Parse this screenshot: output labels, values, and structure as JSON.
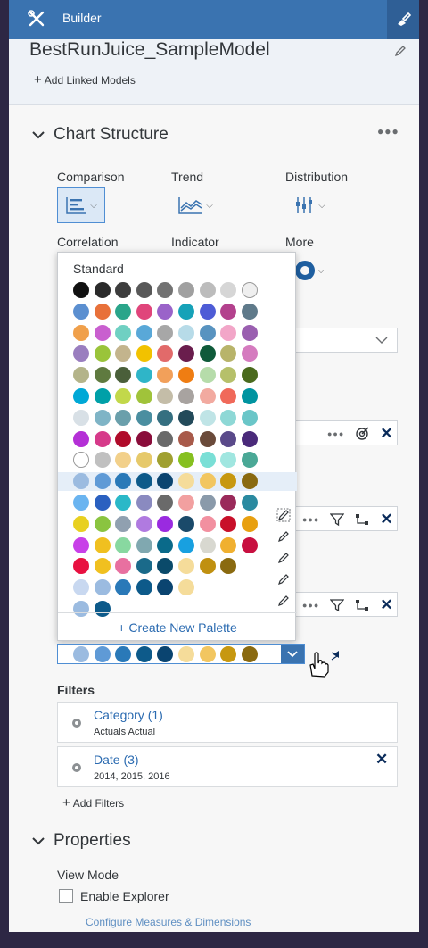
{
  "topbar": {
    "title": "Builder"
  },
  "header": {
    "model_name": "BestRunJuice_SampleModel",
    "add_linked": "Add Linked Models"
  },
  "chart_structure": {
    "title": "Chart Structure",
    "types": [
      {
        "label": "Comparison",
        "icon": "comparison-icon",
        "active": true
      },
      {
        "label": "Trend",
        "icon": "trend-icon",
        "active": false
      },
      {
        "label": "Distribution",
        "icon": "distribution-icon",
        "active": false
      },
      {
        "label": "Correlation",
        "icon": "correlation-icon",
        "active": false
      },
      {
        "label": "Indicator",
        "icon": "indicator-icon",
        "active": false
      },
      {
        "label": "More",
        "icon": "donut-icon",
        "active": false
      }
    ]
  },
  "palette_popup": {
    "header": "Standard",
    "create_label": "+ Create New Palette",
    "selected_row": 9,
    "palettes": [
      [
        "#111111",
        "#2a2a2a",
        "#3d3d3d",
        "#585858",
        "#727272",
        "#a0a0a0",
        "#bcbcbc",
        "#d6d6d6",
        "#efefef"
      ],
      [
        "#5b8fd0",
        "#e8713a",
        "#2aa58a",
        "#e0457b",
        "#9a63c9",
        "#16a2b8",
        "#4e5cd6",
        "#b3418d",
        "#5f7a8a"
      ],
      [
        "#f0a04b",
        "#c95fcf",
        "#6fd0c2",
        "#59a8d8",
        "#a7a7a7",
        "#b7dbe8",
        "#5893c0",
        "#f2a6c8",
        "#9a5fb0"
      ],
      [
        "#9a7ebf",
        "#9ac43a",
        "#c3b48d",
        "#f2c200",
        "#e26a6a",
        "#6a1d4d",
        "#0f5a3a",
        "#b8b46a",
        "#d57bbf"
      ],
      [
        "#b4b48a",
        "#5f7a3f",
        "#4a5f3a",
        "#2fb5c8",
        "#f2a05a",
        "#ef7d12",
        "#b6dcaa",
        "#b6c06a",
        "#4a6a1d"
      ],
      [
        "#00a8d6",
        "#00a0a8",
        "#c2d84a",
        "#a0c33a",
        "#c4bda8",
        "#a8a3a0",
        "#f2aaa0",
        "#f0695a",
        "#0094a0"
      ],
      [
        "#d8e0e6",
        "#7fb4c6",
        "#6a9fab",
        "#4a8ea0",
        "#356f80",
        "#234a5a",
        "#bfe4e6",
        "#8ed8d6",
        "#6ac6c8"
      ],
      [
        "#b430d6",
        "#d63a8a",
        "#b00b2a",
        "#8a0d3a",
        "#6a6a6a",
        "#a85a4a",
        "#6a4a3a",
        "#5a4a8a",
        "#4a2a7a"
      ],
      [
        "#ffffff",
        "#c0c0c0",
        "#f2d08a",
        "#e6c96a",
        "#a0a030",
        "#86c020",
        "#7adfd6",
        "#a0e6e0",
        "#4aa896"
      ],
      [
        "#9bbbe0",
        "#5f9ad6",
        "#2a79b8",
        "#0d5a8a",
        "#0a4470",
        "#f5dc9a",
        "#f2c660",
        "#c79810",
        "#8a6a10"
      ],
      [
        "#6ab4f0",
        "#2a60c0",
        "#2ab8c8",
        "#8a8ac0",
        "#6a6a6a",
        "#f2a0a0",
        "#8a9aaa",
        "#9a2a5a",
        "#2a8aa0"
      ],
      [
        "#e8d020",
        "#8ac440",
        "#90a0b0",
        "#b07ae0",
        "#9a2ae0",
        "#1a4a6a",
        "#f290a0",
        "#c8102a",
        "#e8a010"
      ],
      [
        "#c840e8",
        "#f0c020",
        "#88d8a0",
        "#80a8b0",
        "#0a6a8a",
        "#18a0e0",
        "#d8d8d0",
        "#f0b030",
        "#c81040"
      ],
      [
        "#e81040",
        "#f0c020",
        "#e870a0",
        "#1a6a8a",
        "#0a4a6a",
        "#f5dc9a",
        "#c09010",
        "#8a6a10"
      ],
      [
        "#c8d8f0",
        "#9bbbe0",
        "#2a79b8",
        "#0d5a8a",
        "#0a4470",
        "#f5dc9a"
      ],
      [
        "#9bbbe0",
        "#0d5a8a"
      ]
    ]
  },
  "selected_palette": [
    "#9bbbe0",
    "#5f9ad6",
    "#2a79b8",
    "#0d5a8a",
    "#0a4470",
    "#f5dc9a",
    "#f2c660",
    "#c79810",
    "#8a6a10"
  ],
  "filters": {
    "title": "Filters",
    "items": [
      {
        "name": "Category (1)",
        "values": "Actuals Actual",
        "removable": false
      },
      {
        "name": "Date (3)",
        "values": "2014, 2015, 2016",
        "removable": true
      }
    ],
    "add_label": "Add Filters"
  },
  "properties": {
    "title": "Properties",
    "view_mode_label": "View Mode",
    "enable_explorer_label": "Enable Explorer",
    "configure_link": "Configure Measures & Dimensions"
  }
}
